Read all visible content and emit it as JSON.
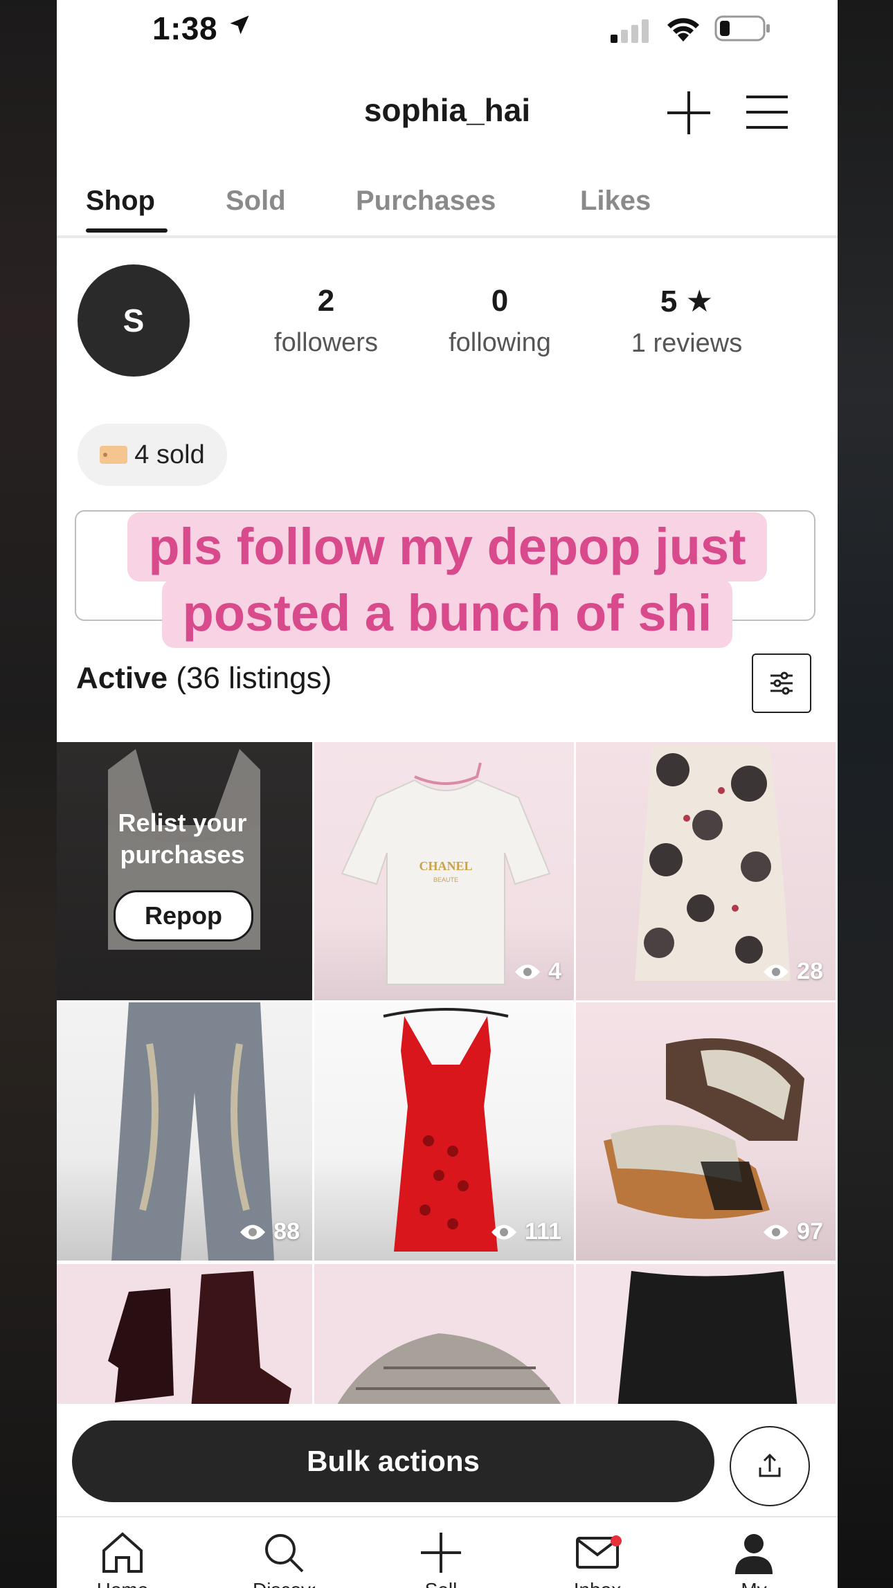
{
  "status": {
    "time": "1:38"
  },
  "header": {
    "username": "sophia_hai"
  },
  "tabs": [
    {
      "label": "Shop"
    },
    {
      "label": "Sold"
    },
    {
      "label": "Purchases"
    },
    {
      "label": "Likes"
    }
  ],
  "profile": {
    "avatar_initial": "S",
    "followers": {
      "value": "2",
      "label": "followers"
    },
    "following": {
      "value": "0",
      "label": "following"
    },
    "reviews": {
      "value": "5 ★",
      "label": "1 reviews"
    },
    "sold_badge": "4 sold"
  },
  "caption": {
    "line1": "pls follow my depop just",
    "line2": "posted a bunch of shi"
  },
  "listings": {
    "active_label": "Active",
    "count_text": "(36 listings)"
  },
  "relist": {
    "title_line1": "Relist your",
    "title_line2": "purchases",
    "button": "Repop"
  },
  "items": [
    {
      "name": "white chanel tee",
      "views": "4"
    },
    {
      "name": "pin-up print dress",
      "views": "28"
    },
    {
      "name": "distressed jeans",
      "views": "88"
    },
    {
      "name": "red knit dress",
      "views": "111"
    },
    {
      "name": "wedge sandals",
      "views": "97"
    },
    {
      "name": "black boots",
      "views": ""
    },
    {
      "name": "plaid skirt",
      "views": ""
    },
    {
      "name": "black ribbed top",
      "views": ""
    }
  ],
  "actions": {
    "bulk": "Bulk actions"
  },
  "nav": [
    {
      "label": "Home",
      "icon": "home-icon"
    },
    {
      "label": "Discover",
      "icon": "search-icon"
    },
    {
      "label": "Sell",
      "icon": "plus-icon"
    },
    {
      "label": "Inbox",
      "icon": "mail-icon"
    },
    {
      "label": "My Depop",
      "icon": "profile-icon"
    }
  ],
  "colors": {
    "caption_bg": "#f8d3e3",
    "caption_text": "#d94a8c",
    "badge_red": "#e5303b"
  }
}
